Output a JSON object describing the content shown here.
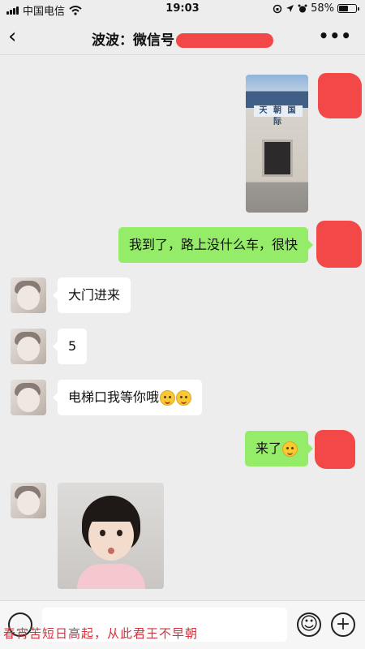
{
  "status_bar": {
    "carrier": "中国电信",
    "time": "19:03",
    "battery_percent": "58%",
    "battery_level": 0.58,
    "icons": [
      "signal-icon",
      "wifi-icon",
      "rotation-lock-icon",
      "location-icon",
      "alarm-icon",
      "battery-icon"
    ]
  },
  "header": {
    "back_icon": "chevron-left-icon",
    "title": "波波：微信号",
    "more_icon": "more-icon"
  },
  "messages": [
    {
      "side": "out",
      "type": "image",
      "content": "building-photo"
    },
    {
      "side": "out",
      "type": "text",
      "text": "我到了，路上没什么车，很快"
    },
    {
      "side": "in",
      "type": "text",
      "text": "大门进来"
    },
    {
      "side": "in",
      "type": "text",
      "text": "5"
    },
    {
      "side": "in",
      "type": "text",
      "text": "电梯口我等你哦"
    },
    {
      "side": "out",
      "type": "text",
      "text": "来了"
    },
    {
      "side": "in",
      "type": "image",
      "content": "girl-photo"
    }
  ],
  "photo_sign_text": "天 朝 国 际",
  "input_bar": {
    "voice_icon": "voice-icon",
    "emoji_icon": "emoji-icon",
    "plus_icon": "plus-icon"
  },
  "watermark": "春宵苦短日高起，从此君王不早朝",
  "colors": {
    "background": "#ededed",
    "outgoing_bubble": "#95ec69",
    "incoming_bubble": "#ffffff",
    "redaction": "#f24848",
    "watermark": "#d3313b"
  }
}
